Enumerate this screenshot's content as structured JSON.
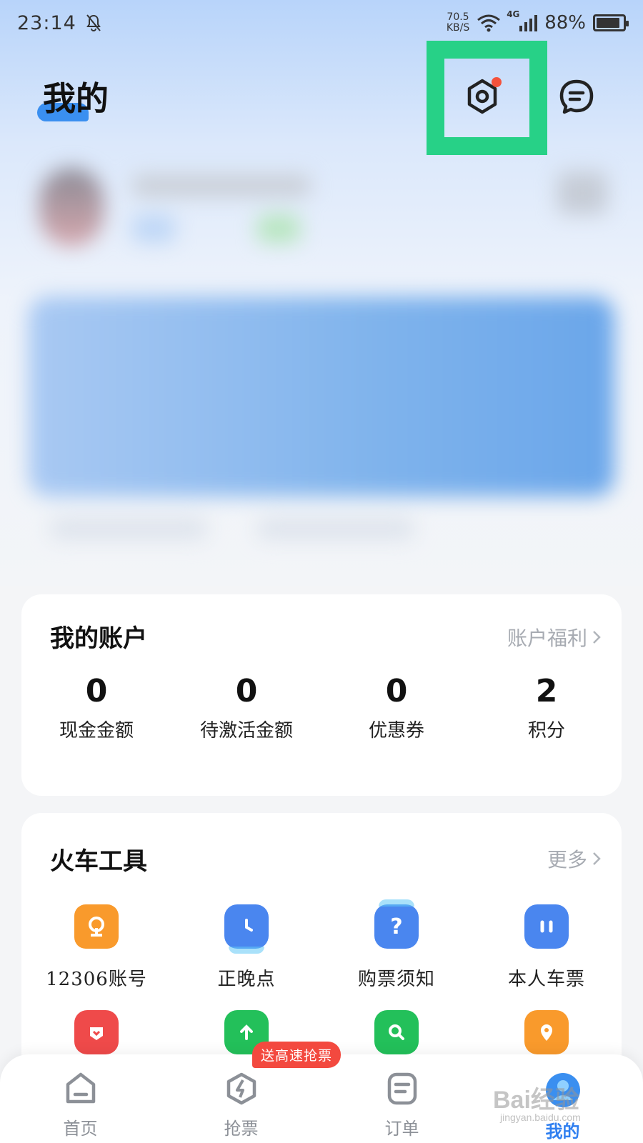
{
  "status_bar": {
    "time": "23:14",
    "net_speed_value": "70.5",
    "net_speed_unit": "KB/S",
    "network_type": "4G",
    "battery_text": "88%",
    "battery_level": 0.88
  },
  "header": {
    "title": "我的",
    "settings_icon": "settings-gear-icon",
    "message_icon": "message-bubble-icon",
    "highlight_color": "#27d187"
  },
  "account": {
    "title": "我的账户",
    "link": "账户福利",
    "stats": [
      {
        "value": "0",
        "label": "现金金额"
      },
      {
        "value": "0",
        "label": "待激活金额"
      },
      {
        "value": "0",
        "label": "优惠券"
      },
      {
        "value": "2",
        "label": "积分"
      }
    ]
  },
  "tools": {
    "title": "火车工具",
    "link": "更多",
    "items": [
      {
        "label": "12306账号",
        "icon": "railway-logo-icon",
        "color": "#f99a2c"
      },
      {
        "label": "正晚点",
        "icon": "clock-icon",
        "color": "#4a86ef"
      },
      {
        "label": "购票须知",
        "icon": "question-icon",
        "color": "#4a86ef"
      },
      {
        "label": "本人车票",
        "icon": "ticket-bag-icon",
        "color": "#4a86ef"
      },
      {
        "label": "",
        "icon": "red-ticket-icon",
        "color": "#ef4a4a"
      },
      {
        "label": "",
        "icon": "upload-ticket-icon",
        "color": "#23c05a"
      },
      {
        "label": "",
        "icon": "search-ticket-icon",
        "color": "#23c05a"
      },
      {
        "label": "",
        "icon": "location-pin-icon",
        "color": "#f99a2c"
      }
    ]
  },
  "bottom_nav": {
    "items": [
      {
        "label": "首页",
        "icon": "home-icon"
      },
      {
        "label": "抢票",
        "icon": "lightning-icon",
        "badge": "送高速抢票"
      },
      {
        "label": "订单",
        "icon": "order-list-icon"
      },
      {
        "label": "我的",
        "icon": "profile-icon",
        "active": true
      }
    ]
  },
  "watermark": {
    "text": "Bai经验",
    "sub": "jingyan.baidu.com"
  }
}
